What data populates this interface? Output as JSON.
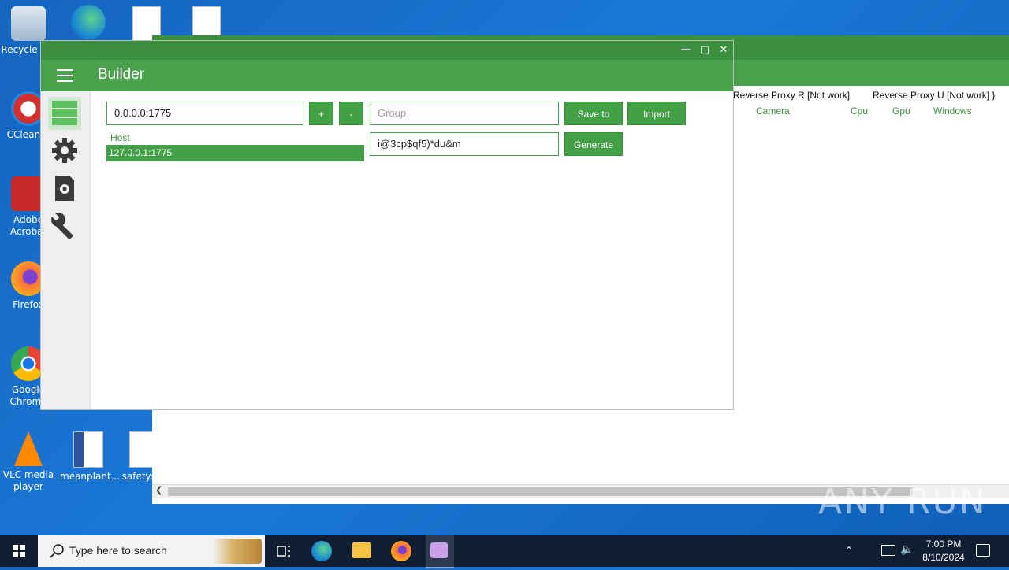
{
  "desktop_icons": [
    {
      "name": "recycle-bin",
      "label": "Recycle Bin"
    },
    {
      "name": "ccleaner",
      "label": "CCleaner"
    },
    {
      "name": "adobe-acrobat",
      "label": "Adobe Acrobat"
    },
    {
      "name": "firefox",
      "label": "Firefox"
    },
    {
      "name": "google-chrome",
      "label": "Google Chrome"
    },
    {
      "name": "vlc",
      "label": "VLC media player"
    },
    {
      "name": "meanplant",
      "label": "meanplant..."
    },
    {
      "name": "safetys",
      "label": "safetys..."
    }
  ],
  "bg_window": {
    "columns": [
      "Reverse Proxy R [Not work]",
      "Reverse Proxy U [Not work] }"
    ],
    "subcolumns": [
      "Camera",
      "Cpu",
      "Gpu",
      "Windows"
    ]
  },
  "builder": {
    "title": "Builder",
    "host_input": "0.0.0.0:1775",
    "add_label": "+",
    "remove_label": "-",
    "group_placeholder": "Group",
    "save_label": "Save to",
    "import_label": "Import",
    "mutex_value": "i@3cp$qf5)*du&m",
    "generate_label": "Generate",
    "host_header": "Host",
    "hosts": [
      "127.0.0.1:1775"
    ]
  },
  "watermark": "ANY RUN",
  "taskbar": {
    "search_placeholder": "Type here to search",
    "time": "7:00 PM",
    "date": "8/10/2024"
  },
  "colors": {
    "accent": "#43a047",
    "titlebar": "#3d8f40",
    "desktop": "#1a78d6",
    "taskbar": "#0f1e33"
  }
}
